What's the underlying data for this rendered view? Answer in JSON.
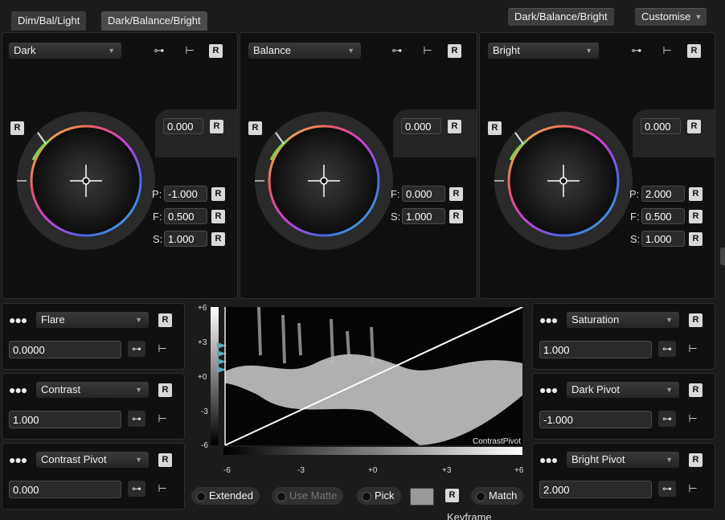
{
  "tabs": [
    {
      "label": "Dim/Bal/Light"
    },
    {
      "label": "Dark/Balance/Bright"
    }
  ],
  "header": {
    "mode_button": "Dark/Balance/Bright",
    "customise_label": "Customise"
  },
  "wheels": [
    {
      "dropdown": "Dark",
      "top_value": "0.000",
      "p_label": "P:",
      "p_value": "-1.000",
      "f_label": "F:",
      "f_value": "0.500",
      "s_label": "S:",
      "s_value": "1.000"
    },
    {
      "dropdown": "Balance",
      "top_value": "0.000",
      "f_label": "F:",
      "f_value": "0.000",
      "s_label": "S:",
      "s_value": "1.000"
    },
    {
      "dropdown": "Bright",
      "top_value": "0.000",
      "p_label": "P:",
      "p_value": "2.000",
      "f_label": "F:",
      "f_value": "0.500",
      "s_label": "S:",
      "s_value": "1.000"
    }
  ],
  "reset_label": "R",
  "left_params": [
    {
      "name": "Flare",
      "value": "0.0000"
    },
    {
      "name": "Contrast",
      "value": "1.000"
    },
    {
      "name": "Contrast Pivot",
      "value": "0.000"
    }
  ],
  "right_params": [
    {
      "name": "Saturation",
      "value": "1.000"
    },
    {
      "name": "Dark Pivot",
      "value": "-1.000"
    },
    {
      "name": "Bright Pivot",
      "value": "2.000"
    }
  ],
  "graph": {
    "y_ticks": [
      "+6",
      "+3",
      "+0",
      "-3",
      "-6"
    ],
    "x_ticks": [
      "-6",
      "-3",
      "+0",
      "+3",
      "+6"
    ],
    "overlay_label": "ContrastPivot"
  },
  "bottom": {
    "extended": "Extended",
    "use_matte": "Use Matte",
    "pick": "Pick",
    "match": "Match",
    "footer_cut": "Keyframe"
  },
  "colors": {
    "panel_bg": "#101010",
    "app_bg": "#1b1b1b",
    "button_bg": "#3d3d3d",
    "reset_bg": "#d9d9d9"
  }
}
